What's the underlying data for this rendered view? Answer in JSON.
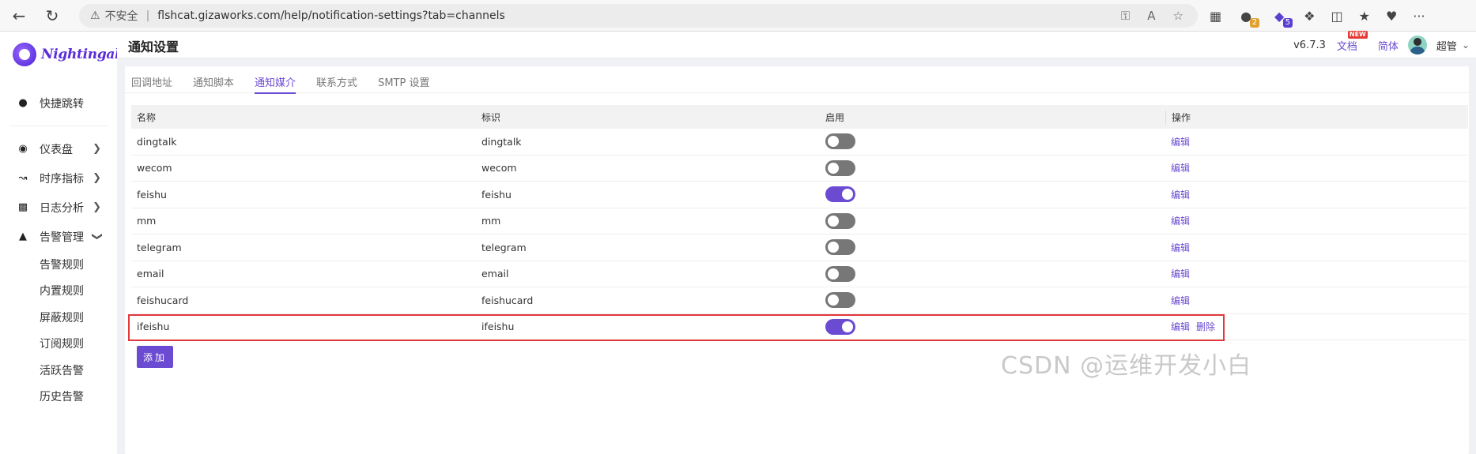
{
  "browser": {
    "security_label": "不安全",
    "url": "flshcat.gizaworks.com/help/notification-settings?tab=channels",
    "badge_counts": [
      "2",
      "5"
    ]
  },
  "brand": {
    "name": "Nightingale"
  },
  "header": {
    "title": "通知设置",
    "version": "v6.7.3",
    "docs_label": "文档",
    "new_badge": "NEW",
    "language": "简体",
    "user": "超管"
  },
  "sidebar": {
    "items": [
      {
        "label": "快捷跳转",
        "icon": "search-icon",
        "has_children": false
      },
      {
        "label": "仪表盘",
        "icon": "dashboard-icon",
        "has_children": true,
        "expanded": false
      },
      {
        "label": "时序指标",
        "icon": "line-chart-icon",
        "has_children": true,
        "expanded": false
      },
      {
        "label": "日志分析",
        "icon": "log-icon",
        "has_children": true,
        "expanded": false
      },
      {
        "label": "告警管理",
        "icon": "alarm-icon",
        "has_children": true,
        "expanded": true
      }
    ],
    "alarm_sub_items": [
      "告警规则",
      "内置规则",
      "屏蔽规则",
      "订阅规则",
      "活跃告警",
      "历史告警"
    ]
  },
  "tabs": [
    {
      "label": "回调地址",
      "active": false
    },
    {
      "label": "通知脚本",
      "active": false
    },
    {
      "label": "通知媒介",
      "active": true
    },
    {
      "label": "联系方式",
      "active": false
    },
    {
      "label": "SMTP 设置",
      "active": false
    }
  ],
  "table": {
    "columns": [
      "名称",
      "标识",
      "启用",
      "操作"
    ],
    "rows": [
      {
        "name": "dingtalk",
        "ident": "dingtalk",
        "enabled": false,
        "actions": [
          "编辑"
        ]
      },
      {
        "name": "wecom",
        "ident": "wecom",
        "enabled": false,
        "actions": [
          "编辑"
        ]
      },
      {
        "name": "feishu",
        "ident": "feishu",
        "enabled": true,
        "actions": [
          "编辑"
        ]
      },
      {
        "name": "mm",
        "ident": "mm",
        "enabled": false,
        "actions": [
          "编辑"
        ]
      },
      {
        "name": "telegram",
        "ident": "telegram",
        "enabled": false,
        "actions": [
          "编辑"
        ]
      },
      {
        "name": "email",
        "ident": "email",
        "enabled": false,
        "actions": [
          "编辑"
        ]
      },
      {
        "name": "feishucard",
        "ident": "feishucard",
        "enabled": false,
        "actions": [
          "编辑"
        ]
      },
      {
        "name": "ifeishu",
        "ident": "ifeishu",
        "enabled": true,
        "actions": [
          "编辑",
          "删除"
        ]
      }
    ]
  },
  "add_button": "添加",
  "watermark": "CSDN @运维开发小白",
  "colors": {
    "accent": "#6b4bd1",
    "highlight": "#e0383b"
  }
}
